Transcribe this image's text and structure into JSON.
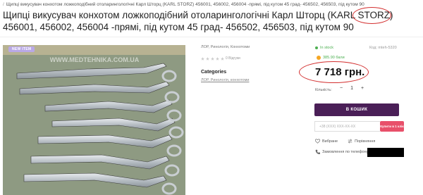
{
  "breadcrumb": {
    "separator": "/",
    "current": "Щипці викусувач конхотом ложкоподібний отоларингологічні Карл Шторц (KARL STORZ) 456001, 456002, 456004 -прямі, під кутом 45 град- 456502, 456503, під кутом 90"
  },
  "product": {
    "title": "Щипці викусувач конхотом ложкоподібний отоларингологічні Карл Шторц (KARL STORZ) 456001, 456002, 456004 -прямі, під кутом 45 град- 456502, 456503, під кутом 90",
    "badge": "NEW ITEM",
    "photo_watermark": "WWW.MEDTEHNIKA.COM.UA",
    "categories_meta": "ЛОР, Ринологія, Конхотоми",
    "reviews_label": "0 Відгуки",
    "categories_heading": "Categories",
    "category_link": "ЛОР, Ринологія, конхотоми"
  },
  "buy_box": {
    "stock": "In stock",
    "sku": "Код: mteh-5320",
    "bonus": "385.90 бали",
    "price": "7 718 грн.",
    "qty_label": "Кількість:",
    "qty_minus": "−",
    "qty_value": "1",
    "qty_plus": "+",
    "cart_button": "В КОШИК",
    "phone_placeholder": "+38 (XXX) XXX-XX-XX",
    "buy_one_click": "Купити в 1 клік",
    "wishlist": "Вибране",
    "compare": "Порівняння",
    "phone_order": "Замовлення по телефону:"
  },
  "colors": {
    "accent": "#4a1f57",
    "one_click": "#e8506a",
    "stock": "#4caf50",
    "highlight": "#d32f2f"
  }
}
